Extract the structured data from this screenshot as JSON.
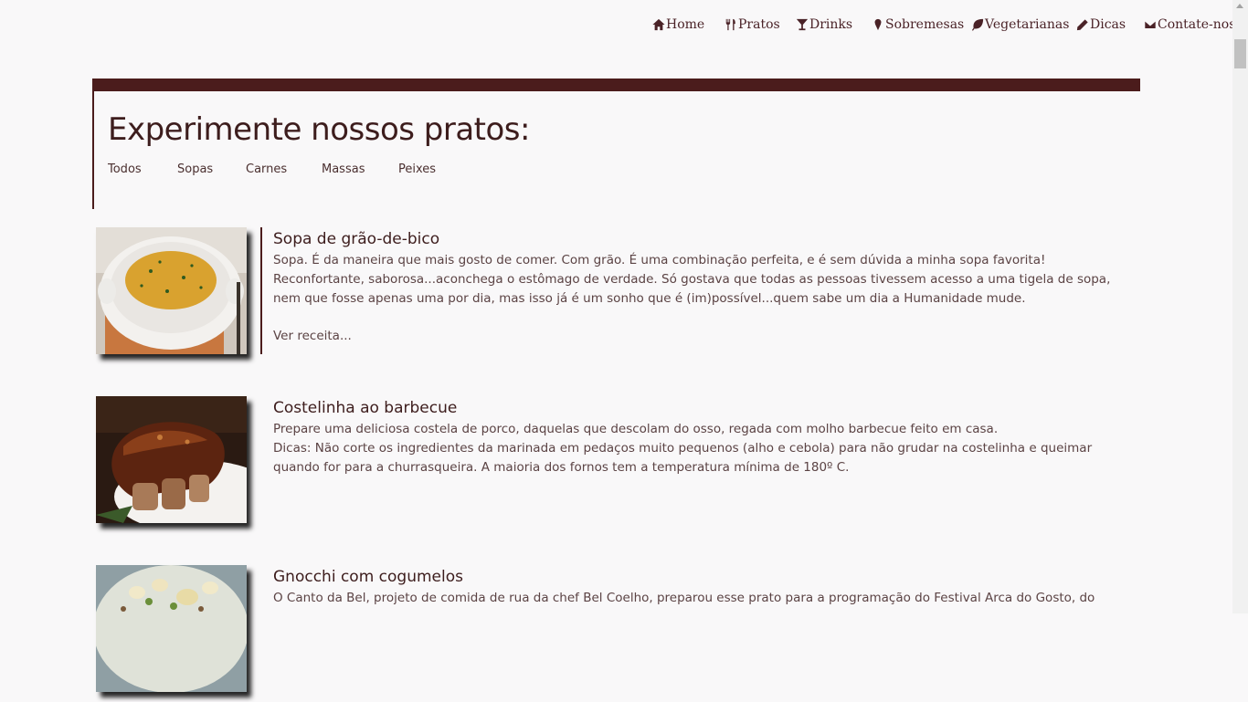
{
  "nav": {
    "items": [
      {
        "label": "Home",
        "icon": "home-icon"
      },
      {
        "label": "Pratos",
        "icon": "utensils-icon"
      },
      {
        "label": "Drinks",
        "icon": "cocktail-glass-icon"
      },
      {
        "label": "Sobremesas",
        "icon": "ice-cream-icon"
      },
      {
        "label": "Vegetarianas",
        "icon": "leaf-icon"
      },
      {
        "label": "Dicas",
        "icon": "pencil-icon"
      },
      {
        "label": "Contate-nos",
        "icon": "envelope-icon"
      }
    ]
  },
  "hero": {
    "title": "Experimente nossos pratos:",
    "filters": [
      "Todos",
      "Sopas",
      "Carnes",
      "Massas",
      "Peixes"
    ]
  },
  "dishes": [
    {
      "title": "Sopa de grão-de-bico",
      "description": [
        "Sopa. É da maneira que mais gosto de comer. Com grão. É uma combinação perfeita, e é sem dúvida a minha sopa favorita! Reconfortante, saborosa...aconchega o estômago de verdade. Só gostava que todas as pessoas tivessem acesso a uma tigela de sopa, nem que fosse apenas uma por dia, mas isso já é um sonho que é (im)possível...quem sabe um dia a Humanidade mude."
      ],
      "link": "Ver receita..."
    },
    {
      "title": "Costelinha ao barbecue",
      "description": [
        "Prepare uma deliciosa costela de porco, daquelas que descolam do osso, regada com molho barbecue feito em casa.",
        "Dicas: Não corte os ingredientes da marinada em pedaços muito pequenos (alho e cebola) para não grudar na costelinha e queimar quando for para a churrasqueira. A maioria dos fornos tem a temperatura mínima de 180º C."
      ]
    },
    {
      "title": "Gnocchi com cogumelos",
      "description": [
        "O Canto da Bel, projeto de comida de rua da chef Bel Coelho, preparou esse prato para a programação do Festival Arca do Gosto, do"
      ]
    }
  ],
  "colors": {
    "accent": "#4b1c1c",
    "text": "#4a2f2f",
    "background": "#f9f8f9"
  }
}
